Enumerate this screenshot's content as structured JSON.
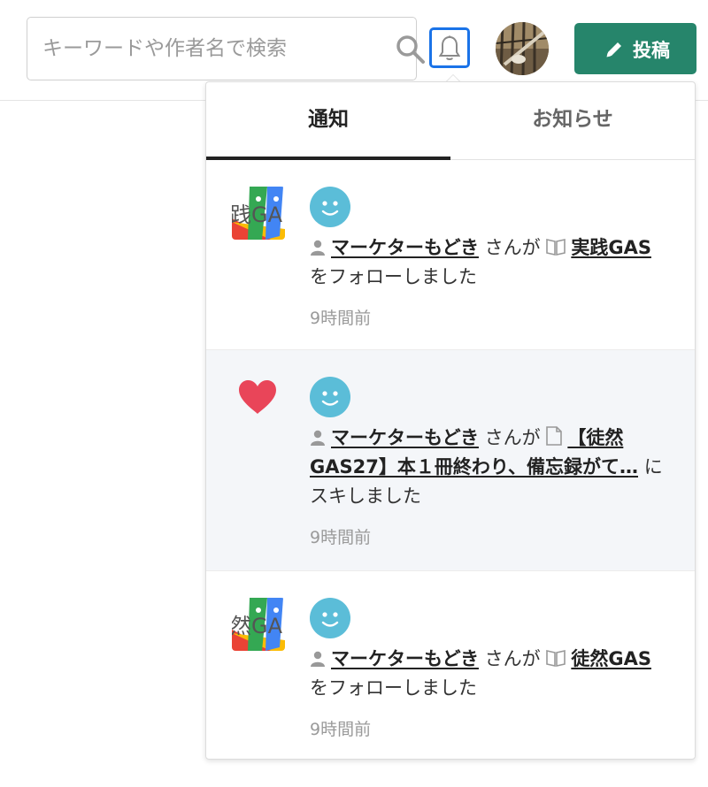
{
  "search": {
    "placeholder": "キーワードや作者名で検索"
  },
  "header": {
    "post_label": "投稿"
  },
  "tabs": [
    {
      "label": "通知"
    },
    {
      "label": "お知らせ"
    }
  ],
  "notifications": [
    {
      "thumb_text": "践GA",
      "user_name": "マーケターもどき",
      "san_ga": "さんが",
      "target_title": "実践GAS",
      "action": "をフォローしました",
      "time": "9時間前"
    },
    {
      "user_name": "マーケターもどき",
      "san_ga": "さんが",
      "target_title": "【徒然GAS27】本１冊終わり、備忘録がて…",
      "action": "にスキしました",
      "time": "9時間前"
    },
    {
      "thumb_text": "然GA",
      "user_name": "マーケターもどき",
      "san_ga": "さんが",
      "target_title": "徒然GAS",
      "action": "をフォローしました",
      "time": "9時間前"
    }
  ],
  "colors": {
    "accent_blue": "#1a73e8",
    "post_green": "#26856b",
    "heart_red": "#e94559",
    "user_icon": "#5bbdd8"
  }
}
